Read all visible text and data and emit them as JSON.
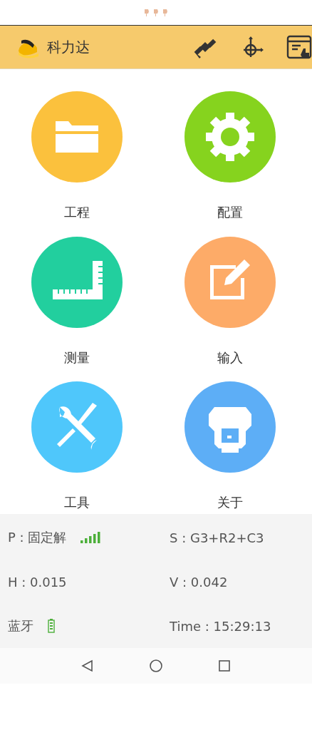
{
  "header": {
    "title": "科力达"
  },
  "tiles": [
    {
      "label": "工程",
      "kind": "folder",
      "color": "#fbc13d"
    },
    {
      "label": "配置",
      "kind": "gear",
      "color": "#86d31e"
    },
    {
      "label": "测量",
      "kind": "ruler",
      "color": "#22cf9e"
    },
    {
      "label": "输入",
      "kind": "edit",
      "color": "#fdab68"
    },
    {
      "label": "工具",
      "kind": "tools",
      "color": "#4fc7fb"
    },
    {
      "label": "关于",
      "kind": "receiver",
      "color": "#5daef6"
    }
  ],
  "info": [
    [
      {
        "text": "P : 固定解",
        "kind": "signal"
      },
      {
        "text": "S : G3+R2+C3"
      }
    ],
    [
      {
        "text": "H : 0.015"
      },
      {
        "text": "V : 0.042"
      }
    ],
    [
      {
        "text": "蓝牙",
        "kind": "battery"
      },
      {
        "text": "Time :  15:29:13"
      }
    ]
  ]
}
